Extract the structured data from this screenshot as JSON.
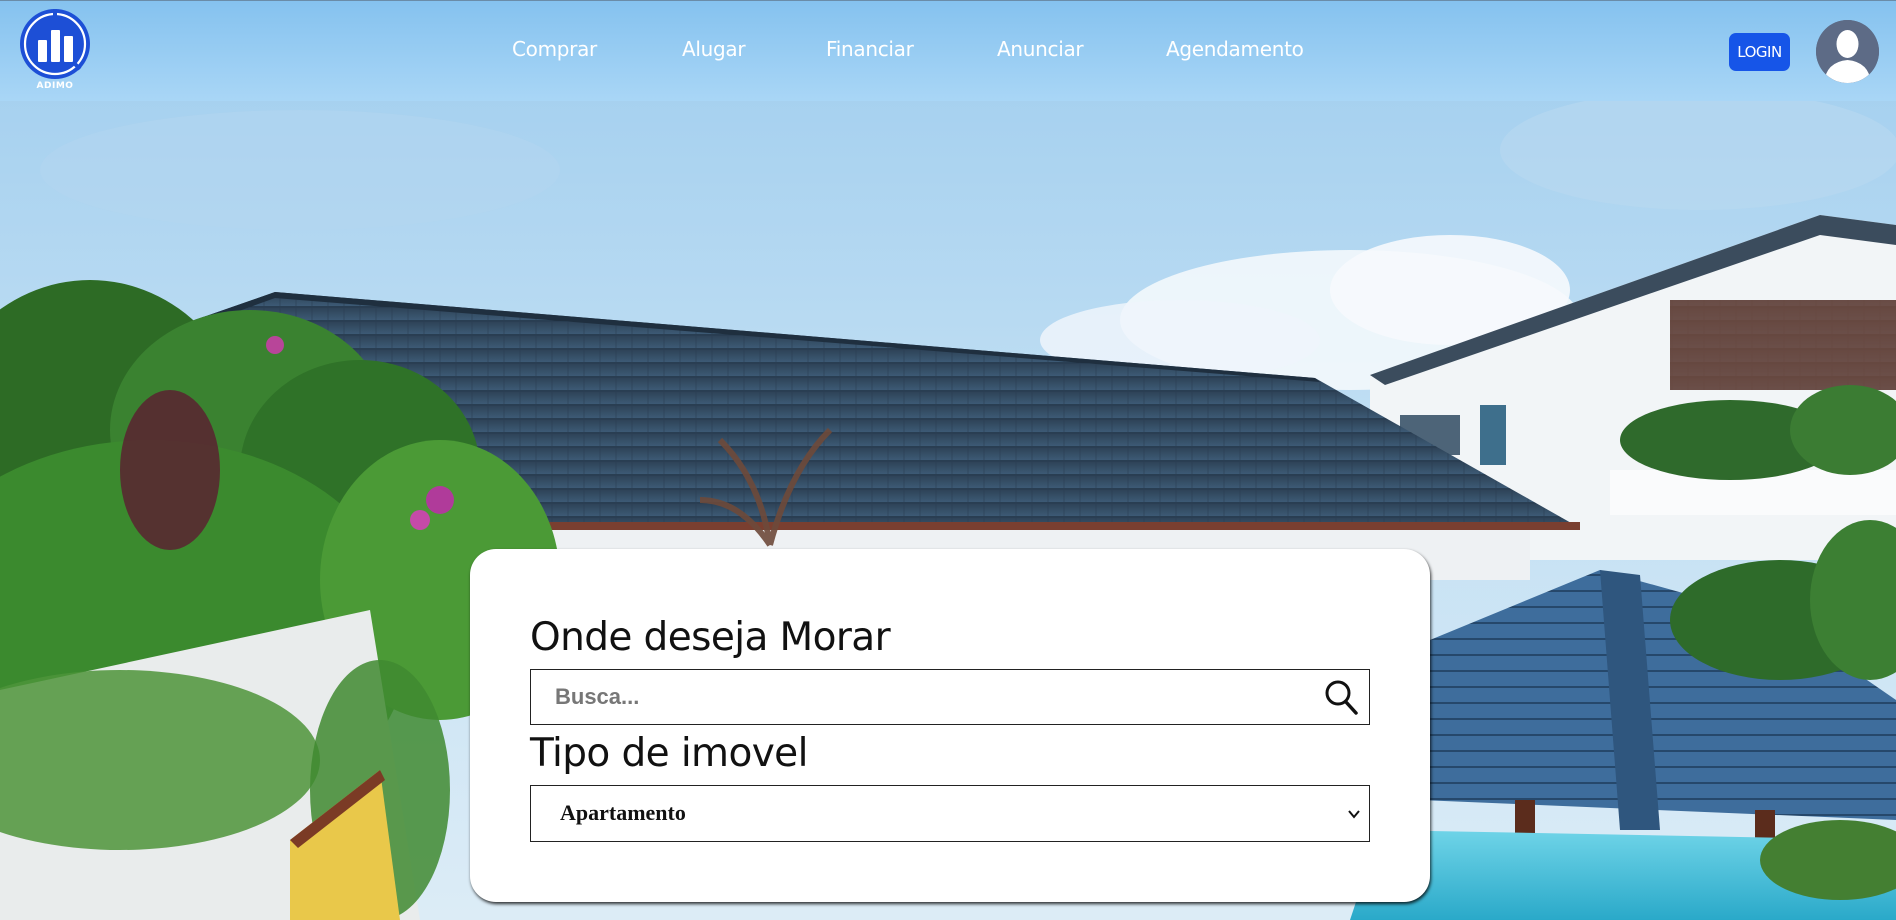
{
  "brand": {
    "name": "ADIMO",
    "accent": "#1655e8"
  },
  "nav": {
    "items": [
      "Comprar",
      "Alugar",
      "Financiar",
      "Anunciar",
      "Agendamento"
    ]
  },
  "header": {
    "login_label": "LOGIN"
  },
  "search_card": {
    "location_title": "Onde deseja Morar",
    "search_placeholder": "Busca...",
    "search_value": "",
    "type_title": "Tipo de imovel",
    "type_selected": "Apartamento"
  },
  "icons": {
    "logo": "bar-chart-logo-icon",
    "search": "search-icon",
    "avatar": "user-avatar-icon",
    "select": "chevron-down-icon"
  }
}
